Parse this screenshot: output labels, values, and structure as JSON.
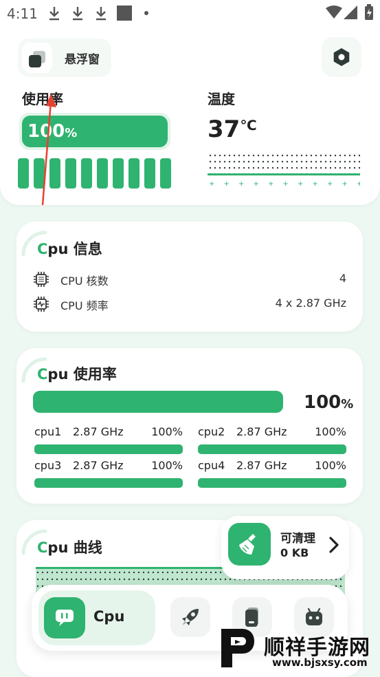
{
  "status_bar": {
    "time": "4:11"
  },
  "header": {
    "float_window_label": "悬浮窗"
  },
  "usage": {
    "title": "使用率",
    "value_num": "100",
    "value_unit": "%",
    "level": 1.0
  },
  "temperature": {
    "title": "温度",
    "value": "37",
    "unit": "℃"
  },
  "cpu_info": {
    "title_c": "C",
    "title_rest": "pu 信息",
    "rows": [
      {
        "label": "CPU 核数",
        "value": "4",
        "icon": "chip-icon"
      },
      {
        "label": "CPU 频率",
        "value": "4 x 2.87 GHz",
        "icon": "frequency-icon"
      }
    ]
  },
  "cpu_usage": {
    "title_c": "C",
    "title_rest": "pu 使用率",
    "total_num": "100",
    "total_unit": "%",
    "total_level": 1.0,
    "cores": [
      {
        "name": "cpu1",
        "freq": "2.87 GHz",
        "percent": "100%",
        "level": 1.0
      },
      {
        "name": "cpu2",
        "freq": "2.87 GHz",
        "percent": "100%",
        "level": 1.0
      },
      {
        "name": "cpu3",
        "freq": "2.87 GHz",
        "percent": "100%",
        "level": 1.0
      },
      {
        "name": "cpu4",
        "freq": "2.87 GHz",
        "percent": "100%",
        "level": 1.0
      }
    ]
  },
  "cpu_curve": {
    "title_c": "C",
    "title_rest": "pu 曲线"
  },
  "clean_popup": {
    "title": "可清理",
    "size": "0 KB"
  },
  "bottom_nav": {
    "active_label": "Cpu",
    "icons": [
      "cpu-icon",
      "rocket-icon",
      "phone-icon",
      "android-icon"
    ]
  },
  "watermark": {
    "name": "顺祥手游网",
    "url": "www.bjsxsy.com"
  },
  "colors": {
    "accent": "#2fb370",
    "accent_light": "#e3f4ea",
    "background": "#eef8f2"
  }
}
